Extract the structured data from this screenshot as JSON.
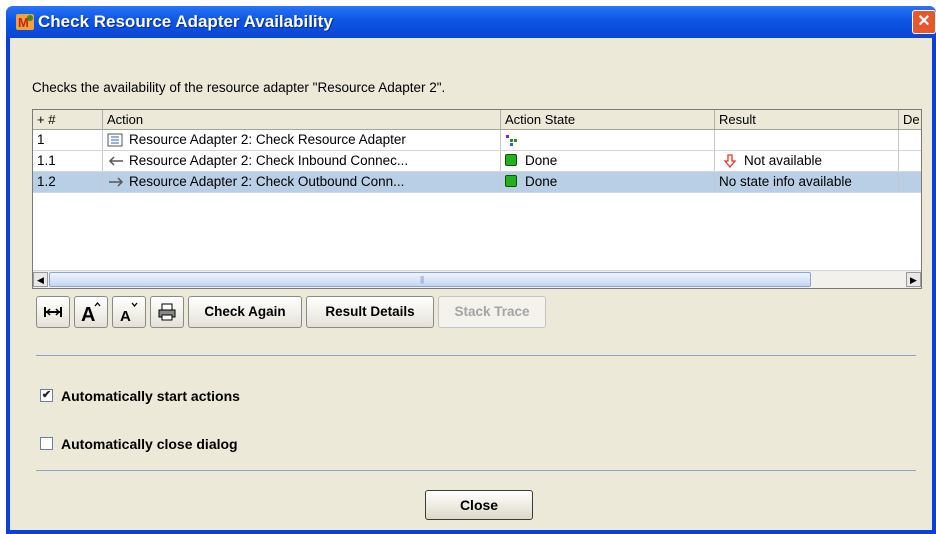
{
  "window": {
    "title": "Check Resource Adapter Availability",
    "close_glyph": "✕"
  },
  "intro_text": "Checks the availability of the resource adapter \"Resource Adapter 2\".",
  "table": {
    "headers": [
      "+ #",
      "Action",
      "Action State",
      "Result",
      "De"
    ],
    "rows": [
      {
        "num": "1",
        "icon": "check-resource-icon",
        "action": "Resource Adapter 2: Check Resource Adapter",
        "state": "",
        "state_icon": "tree-icon",
        "result": "",
        "result_icon": ""
      },
      {
        "num": "1.1",
        "icon": "inbound-arrow-icon",
        "action": "Resource Adapter 2: Check Inbound Connec...",
        "state": "Done",
        "state_icon": "done-icon",
        "result": "Not available",
        "result_icon": "down-arrow-icon"
      },
      {
        "num": "1.2",
        "icon": "outbound-arrow-icon",
        "action": "Resource Adapter 2: Check Outbound Conn...",
        "state": "Done",
        "state_icon": "done-icon",
        "result": "No state info available",
        "result_icon": ""
      }
    ],
    "selected_row": 2
  },
  "toolbar": {
    "fit_columns_icon": "fit-columns-icon",
    "increase_font_icon": "increase-font-icon",
    "decrease_font_icon": "decrease-font-icon",
    "print_icon": "print-icon",
    "check_again": "Check Again",
    "result_details": "Result Details",
    "stack_trace": "Stack Trace"
  },
  "options": {
    "auto_start": {
      "label": "Automatically start actions",
      "checked": true
    },
    "auto_close": {
      "label": "Automatically close dialog",
      "checked": false
    }
  },
  "close_button": "Close",
  "colors": {
    "title_bar": "#0c55e6",
    "dialog_bg": "#ece9d8",
    "selection": "#b8cfe5",
    "done_green": "#22b21e",
    "error_red": "#e8342c"
  }
}
